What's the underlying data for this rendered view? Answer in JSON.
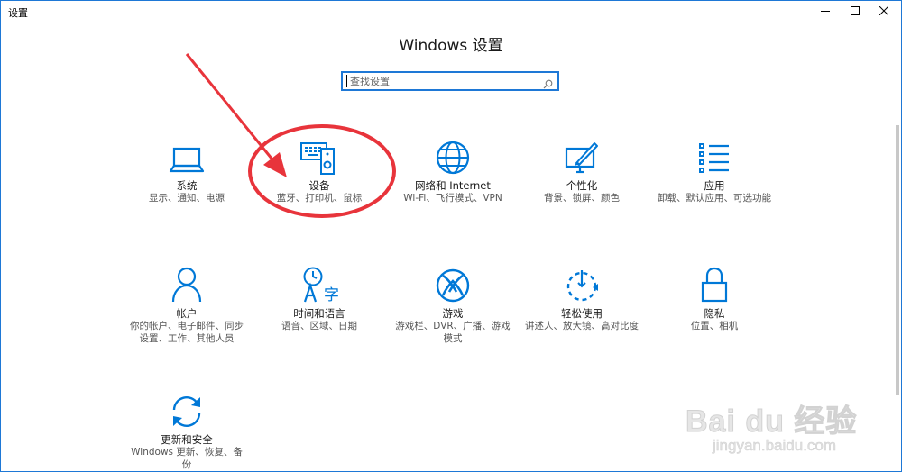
{
  "window": {
    "app_title": "设置"
  },
  "header": {
    "title": "Windows 设置"
  },
  "search": {
    "placeholder": "查找设置"
  },
  "tiles": [
    {
      "label": "系统",
      "desc1": "显示、通知、电源",
      "desc2": "",
      "icon": "laptop-icon"
    },
    {
      "label": "设备",
      "desc1": "蓝牙、打印机、鼠标",
      "desc2": "",
      "icon": "devices-icon"
    },
    {
      "label": "网络和 Internet",
      "desc1": "Wi-Fi、飞行模式、VPN",
      "desc2": "",
      "icon": "globe-icon"
    },
    {
      "label": "个性化",
      "desc1": "背景、锁屏、颜色",
      "desc2": "",
      "icon": "paint-icon"
    },
    {
      "label": "应用",
      "desc1": "卸载、默认应用、可选功能",
      "desc2": "",
      "icon": "apps-list-icon"
    },
    {
      "label": "帐户",
      "desc1": "你的帐户、电子邮件、同步",
      "desc2": "设置、工作、其他人员",
      "icon": "person-icon"
    },
    {
      "label": "时间和语言",
      "desc1": "语音、区域、日期",
      "desc2": "",
      "icon": "time-language-icon"
    },
    {
      "label": "游戏",
      "desc1": "游戏栏、DVR、广播、游戏",
      "desc2": "模式",
      "icon": "xbox-icon"
    },
    {
      "label": "轻松使用",
      "desc1": "讲述人、放大镜、高对比度",
      "desc2": "",
      "icon": "ease-of-access-icon"
    },
    {
      "label": "隐私",
      "desc1": "位置、相机",
      "desc2": "",
      "icon": "lock-icon"
    },
    {
      "label": "更新和安全",
      "desc1": "Windows 更新、恢复、备",
      "desc2": "份",
      "icon": "sync-icon"
    }
  ],
  "colors": {
    "accent": "#0078d7",
    "annotation": "#e8343b"
  },
  "watermark": {
    "main": "Bai du 经验",
    "sub": "jingyan.baidu.com"
  }
}
